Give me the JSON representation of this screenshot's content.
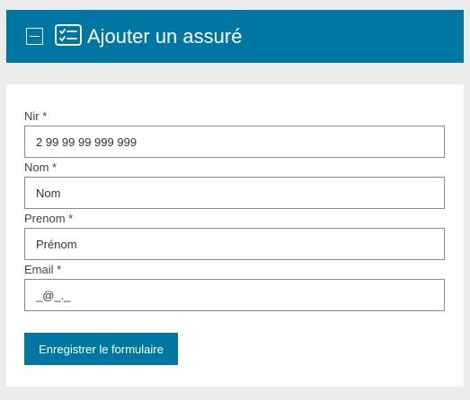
{
  "header": {
    "title": "Ajouter un assuré",
    "collapse_icon": "minus-square-icon",
    "form_icon": "checklist-icon",
    "background_color": "#0077a3"
  },
  "form": {
    "fields": [
      {
        "label": "Nir *",
        "value": "",
        "placeholder": "2 99 99 99 999 999"
      },
      {
        "label": "Nom *",
        "value": "",
        "placeholder": "Nom"
      },
      {
        "label": "Prenom *",
        "value": "",
        "placeholder": "Prénom"
      },
      {
        "label": "Email *",
        "value": "",
        "placeholder": "_@_._"
      }
    ],
    "submit_label": "Enregistrer le formulaire"
  }
}
